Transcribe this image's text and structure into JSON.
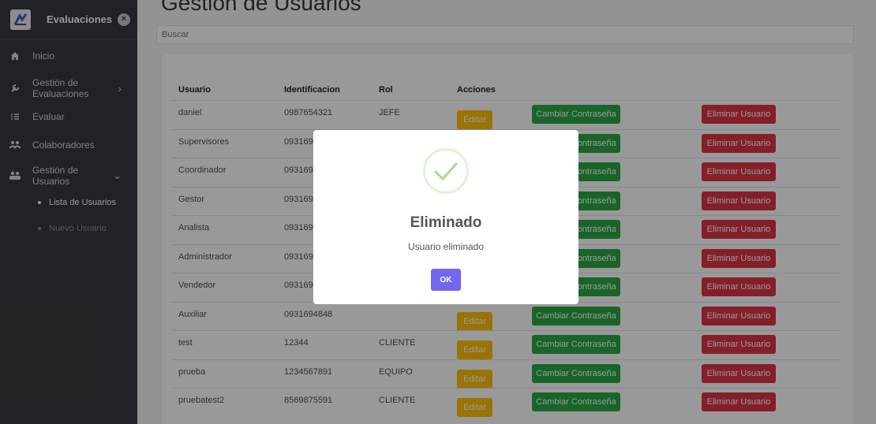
{
  "sidebar": {
    "brand": "Evaluaciones",
    "close_glyph": "×",
    "items": [
      {
        "label": "Inicio",
        "icon": "home-icon"
      },
      {
        "label": "Gestión de Evaluaciones",
        "icon": "wrench-icon"
      },
      {
        "label": "Evaluar",
        "icon": "list-icon"
      },
      {
        "label": "Colaboradores",
        "icon": "users-icon"
      },
      {
        "label": "Gestión de Usuarios",
        "icon": "user-group-icon"
      }
    ],
    "sub_items": [
      {
        "label": "Lista de Usuarios",
        "active": true
      },
      {
        "label": "Nuevo Usuario",
        "active": false
      }
    ]
  },
  "main": {
    "title": "Gestion de Usuarios",
    "search_placeholder": "Buscar",
    "table": {
      "headers": [
        "Usuario",
        "Identificacion",
        "Rol",
        "Acciones"
      ],
      "actions": {
        "edit": "Editar",
        "password": "Cambiar Contraseña",
        "delete": "Eliminar Usuario"
      },
      "rows": [
        {
          "user": "daniel",
          "id": "0987654321",
          "role": "JEFE"
        },
        {
          "user": "Supervisores",
          "id": "093169",
          "role": ""
        },
        {
          "user": "Coordinador",
          "id": "093169",
          "role": ""
        },
        {
          "user": "Gestor",
          "id": "093169",
          "role": ""
        },
        {
          "user": "Analista",
          "id": "093169",
          "role": ""
        },
        {
          "user": "Administrador",
          "id": "093169",
          "role": ""
        },
        {
          "user": "Vendedor",
          "id": "093169",
          "role": ""
        },
        {
          "user": "Auxiliar",
          "id": "0931694848",
          "role": ""
        },
        {
          "user": "test",
          "id": "12344",
          "role": "CLIENTE"
        },
        {
          "user": "prueba",
          "id": "1234567891",
          "role": "EQUIPO"
        },
        {
          "user": "pruebatest2",
          "id": "8569875591",
          "role": "CLIENTE"
        }
      ]
    }
  },
  "modal": {
    "title": "Eliminado",
    "text": "Usuario eliminado",
    "ok_label": "OK"
  },
  "colors": {
    "sidebar": "#343a40",
    "edit": "#ffc107",
    "password": "#28a745",
    "delete": "#dc3545",
    "ok": "#7367f0",
    "success": "#a5dc86"
  }
}
